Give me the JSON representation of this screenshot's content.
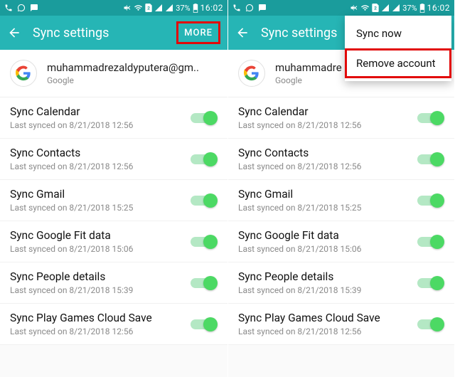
{
  "status": {
    "battery": "37%",
    "time": "16:02"
  },
  "appbar": {
    "title": "Sync settings",
    "more": "MORE"
  },
  "account": {
    "email_full": "muhammadrezaldyputera@gm..",
    "email_trunc": "muhammadre",
    "provider": "Google"
  },
  "sync_items": [
    {
      "title": "Sync Calendar",
      "sub": "Last synced on 8/21/2018  12:56"
    },
    {
      "title": "Sync Contacts",
      "sub": "Last synced on 8/21/2018  12:56"
    },
    {
      "title": "Sync Gmail",
      "sub": "Last synced on 8/21/2018  15:25"
    },
    {
      "title": "Sync Google Fit data",
      "sub": "Last synced on 8/21/2018  15:06"
    },
    {
      "title": "Sync People details",
      "sub": "Last synced on 8/21/2018  15:39"
    },
    {
      "title": "Sync Play Games Cloud Save",
      "sub": "Last synced on 8/21/2018  12:56"
    }
  ],
  "menu": {
    "sync_now": "Sync now",
    "remove": "Remove account"
  }
}
